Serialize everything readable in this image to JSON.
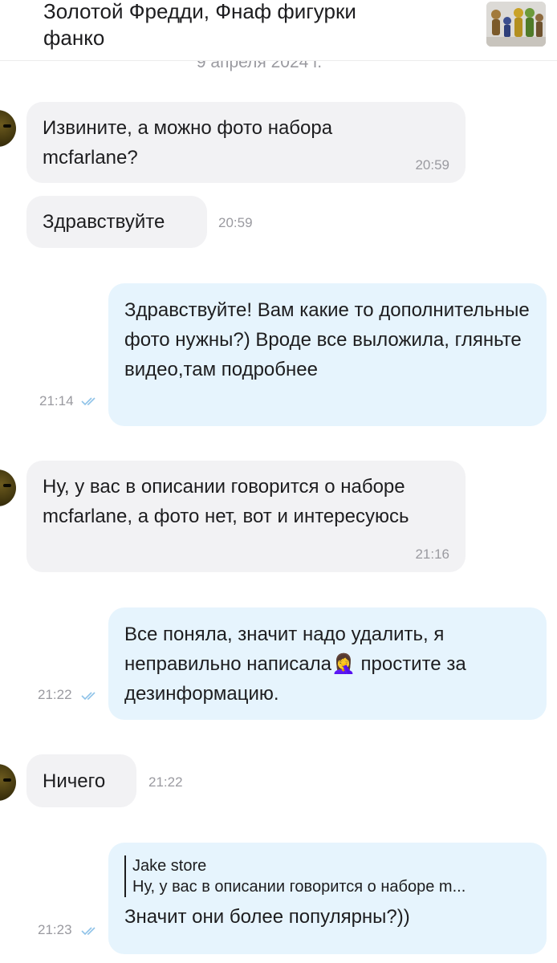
{
  "header": {
    "title": "Золотой Фредди, Фнаф фигурки фанко",
    "thumbnail_icon": "product-thumbnail"
  },
  "date_separator": "9 апреля 2024 г.",
  "colors": {
    "incoming_bubble": "#f2f2f4",
    "outgoing_bubble": "#e6f4fd",
    "read_checks": "#8fc3e8",
    "meta_text": "#9a9aa0"
  },
  "messages": [
    {
      "direction": "incoming",
      "text": "Извините, а можно фото набора mcfarlane?",
      "time": "20:59"
    },
    {
      "direction": "incoming",
      "text": "Здравствуйте",
      "time": "20:59"
    },
    {
      "direction": "outgoing",
      "text": "Здравствуйте! Вам какие то дополнительные фото нужны?) Вроде все выложила, гляньте видео,там подробнее",
      "time": "21:14",
      "status_icon": "double-check-icon"
    },
    {
      "direction": "incoming",
      "text": "Ну, у вас в описании говорится о наборе mcfarlane, а фото нет, вот и интересуюсь",
      "time": "21:16"
    },
    {
      "direction": "outgoing",
      "text_before_emoji": "Все поняла, значит надо удалить, я неправильно написала",
      "emoji": "🤦‍♀️",
      "text_after_emoji": " простите за дезинформацию.",
      "time": "21:22",
      "status_icon": "double-check-icon"
    },
    {
      "direction": "incoming",
      "text": "Ничего",
      "time": "21:22"
    },
    {
      "direction": "outgoing",
      "quote": {
        "author": "Jake store",
        "text": "Ну, у вас в описании говорится о наборе m..."
      },
      "text": "Значит они более популярны?))",
      "time": "21:23",
      "status_icon": "double-check-icon"
    }
  ]
}
